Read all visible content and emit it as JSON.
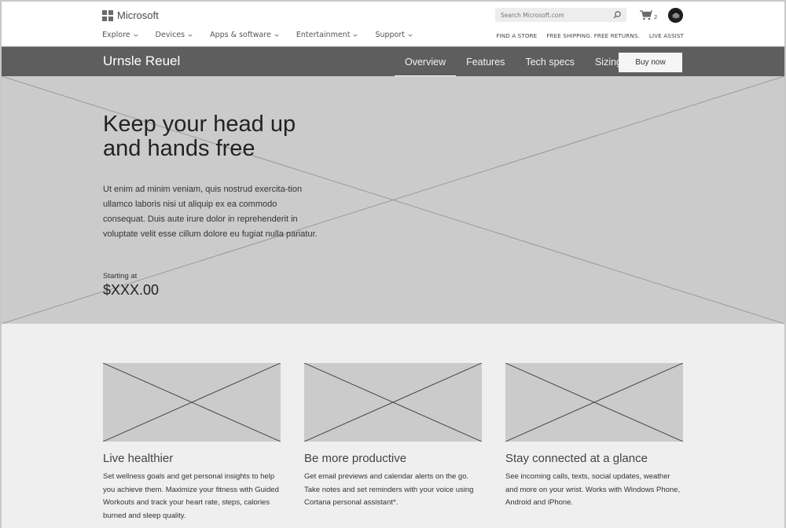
{
  "header": {
    "brand": "Microsoft",
    "nav": [
      {
        "label": "Explore",
        "icon": "chevron-down-icon"
      },
      {
        "label": "Devices",
        "icon": "chevron-down-icon"
      },
      {
        "label": "Apps & software",
        "icon": "chevron-down-icon"
      },
      {
        "label": "Entertainment",
        "icon": "chevron-down-icon"
      },
      {
        "label": "Support",
        "icon": "chevron-down-icon"
      }
    ],
    "search": {
      "placeholder": "Search Microsoft.com",
      "value": "",
      "icon": "search-icon"
    },
    "cart": {
      "icon": "cart-icon",
      "count": "2"
    },
    "avatar_icon": "avatar-icon",
    "utility_links": [
      "FIND A STORE",
      "FREE SHIPPING. FREE RETURNS.",
      "LIVE ASSIST"
    ]
  },
  "product_bar": {
    "title": "Urnsle Reuel",
    "tabs": [
      {
        "label": "Overview",
        "active": true
      },
      {
        "label": "Features",
        "active": false
      },
      {
        "label": "Tech specs",
        "active": false
      },
      {
        "label": "Sizing",
        "active": false
      }
    ],
    "buy_label": "Buy now"
  },
  "hero": {
    "title": "Keep your head up and hands free",
    "body": "Ut enim ad minim veniam, quis nostrud exercita-tion ullamco laboris nisi ut aliquip ex ea commodo consequat. Duis aute irure dolor in reprehenderit in voluptate velit esse cillum dolore eu fugiat nulla pariatur.",
    "price_label": "Starting at",
    "price": "$XXX.00"
  },
  "features": [
    {
      "title": "Live healthier",
      "body": "Set wellness goals and get personal insights to help you achieve them. Maximize your fitness with Guided Workouts and track your heart rate, steps, calories burned and sleep quality."
    },
    {
      "title": "Be more productive",
      "body": "Get email previews and calendar alerts on the go. Take notes and set reminders with your voice using Cortana personal assistant*."
    },
    {
      "title": "Stay connected at a glance",
      "body": "See incoming calls, texts, social updates, weather and more on your wrist. Works with Windows Phone, Android and iPhone."
    }
  ]
}
